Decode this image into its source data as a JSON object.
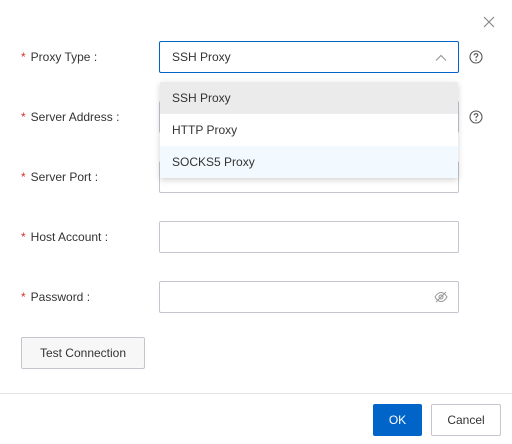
{
  "colors": {
    "primary": "#0064c8",
    "required": "#d93026",
    "border": "#c4c6cf",
    "dropdown_selected_bg": "#ebebeb",
    "dropdown_hover_bg": "#f2f9ff"
  },
  "form": {
    "proxy_type": {
      "required_mark": "*",
      "label": "Proxy Type",
      "colon": ":",
      "value": "SSH Proxy",
      "expanded": true
    },
    "server_address": {
      "required_mark": "*",
      "label": "Server Address",
      "colon": ":",
      "value": ""
    },
    "server_port": {
      "required_mark": "*",
      "label": "Server Port",
      "colon": ":",
      "value": ""
    },
    "host_account": {
      "required_mark": "*",
      "label": "Host Account",
      "colon": ":",
      "value": ""
    },
    "password": {
      "required_mark": "*",
      "label": "Password",
      "colon": ":",
      "value": ""
    }
  },
  "dropdown": {
    "options": [
      "SSH Proxy",
      "HTTP Proxy",
      "SOCKS5 Proxy"
    ],
    "selected": "SSH Proxy",
    "hovered": "SOCKS5 Proxy"
  },
  "buttons": {
    "test_connection": "Test Connection",
    "ok": "OK",
    "cancel": "Cancel"
  },
  "icons": {
    "close": "close-icon",
    "help": "question-circle-icon",
    "chevron": "chevron-up-icon",
    "password_toggle": "eye-slash-icon"
  }
}
